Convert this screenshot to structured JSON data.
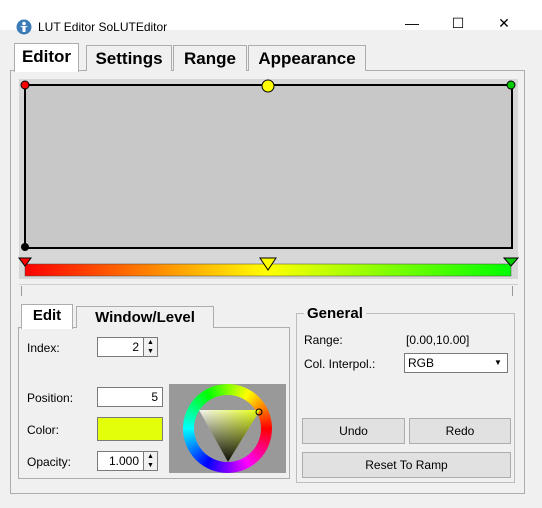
{
  "window": {
    "title": "LUT Editor SoLUTEditor",
    "minimize": "—",
    "maximize": "☐",
    "close": "✕"
  },
  "main_tabs": [
    {
      "label": "Editor",
      "active": true
    },
    {
      "label": "Settings",
      "active": false
    },
    {
      "label": "Range",
      "active": false
    },
    {
      "label": "Appearance",
      "active": false
    }
  ],
  "lut": {
    "background_color": "#c8c8c8",
    "ramp_colors": [
      "#ff0000",
      "#ffff00",
      "#00ff00"
    ],
    "control_points": [
      {
        "index": 0,
        "position": 0,
        "color": "#ff0000",
        "opacity": 1.0
      },
      {
        "index": 1,
        "position": 0,
        "color": "#000000",
        "opacity": 0.0
      },
      {
        "index": 2,
        "position": 5,
        "color": "#e4ff0a",
        "opacity": 1.0
      },
      {
        "index": 3,
        "position": 10,
        "color": "#00cc00",
        "opacity": 1.0
      }
    ]
  },
  "sub_tabs": [
    {
      "label": "Edit",
      "active": true
    },
    {
      "label": "Window/Level",
      "active": false
    }
  ],
  "edit": {
    "index_label": "Index:",
    "index_value": "2",
    "position_label": "Position:",
    "position_value": "5",
    "color_label": "Color:",
    "color_value": "#e4ff0a",
    "opacity_label": "Opacity:",
    "opacity_value": "1.000"
  },
  "general": {
    "title": "General",
    "range_label": "Range:",
    "range_value": "[0.00,10.00]",
    "interp_label": "Col. Interpol.:",
    "interp_value": "RGB",
    "undo_label": "Undo",
    "redo_label": "Redo",
    "reset_label": "Reset To Ramp"
  }
}
